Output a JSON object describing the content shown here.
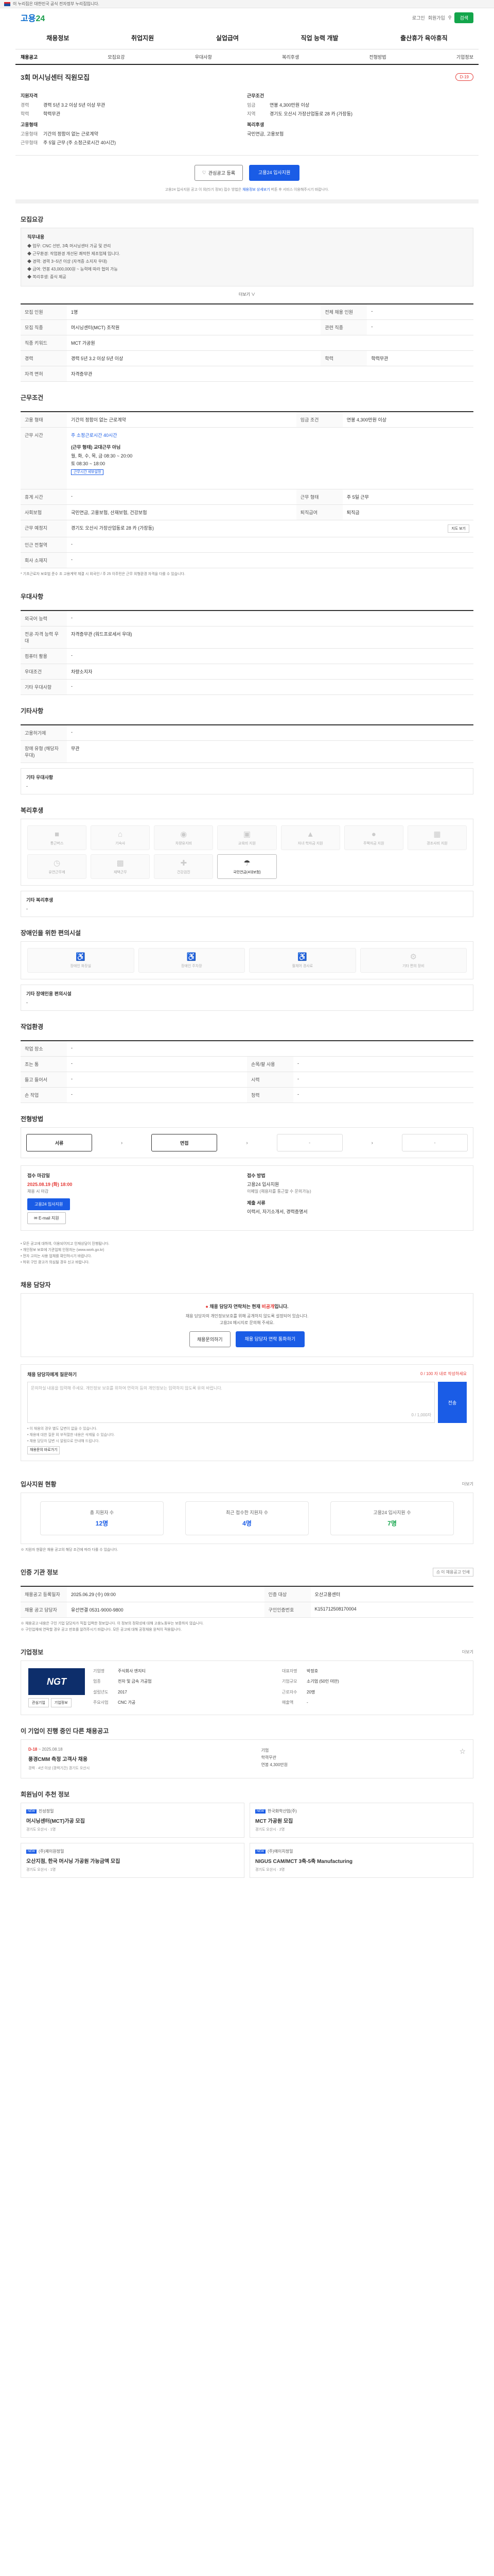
{
  "gov_bar": "이 누리집은 대한민국 공식 전자정부 누리집입니다.",
  "header": {
    "logo_a": "고용",
    "logo_b": "24",
    "login": "로그인",
    "join": "회원가입",
    "search_btn": "검색"
  },
  "gnb": [
    "채용정보",
    "취업지원",
    "실업급여",
    "직업 능력 개발",
    "출산휴가 육아휴직"
  ],
  "tabs": [
    "채용공고",
    "모집요강",
    "우대사항",
    "복리후생",
    "전형방법",
    "기업정보"
  ],
  "job": {
    "title": "3회 머시닝센터 직원모집",
    "dday": "D-19",
    "qual_title": "지원자격",
    "qual": [
      {
        "k": "경력",
        "v": "경력 5년 3.2 이상 5년 이상 무관"
      },
      {
        "k": "학력",
        "v": "학력무관"
      }
    ],
    "cond_title": "근무조건",
    "cond": [
      {
        "k": "임금",
        "v": "연봉 4,300만원 이상"
      },
      {
        "k": "지역",
        "v": "경기도 오산시 가장산업동로 28 카 (가장동)"
      }
    ],
    "emp_title": "고용형태",
    "emp": [
      {
        "k": "고용형태",
        "v": "기간의 정함이 없는 근로계약"
      },
      {
        "k": "근무형태",
        "v": "주 5일 근무 (주 소정근로시간 40시간)"
      }
    ],
    "benefit_title": "복리후생",
    "benefit": "국민연금, 고용보험"
  },
  "actions": {
    "scrap": "관심공고 등록",
    "apply": "고용24 입사지원"
  },
  "notice": {
    "text": "고용24 입사지원 공고 이 외(타기 정보) 접수 방법은",
    "link": "채용정보 상세보기",
    "tail": "버튼 후 서비스 이용해주시기 바랍니다."
  },
  "recruit": {
    "title": "모집요강",
    "box_title": "직무내용",
    "lines": [
      "◆ 업무: CNC 선반, 3축 머시닝센터 가공 및 관리",
      "◆ 근무환경: 작업환경 개선된 쾌적한 제조업체 입니다.",
      "◆ 경력: 경력 3~5년 이상 (자격증 소지자 우대)",
      "◆ 급여: 연봉 43,000,000원 ~ 능력에 따라 협의 가능",
      "◆ 복리후생: 중식 제공"
    ],
    "more": "더보기",
    "rows": [
      [
        "모집 인원",
        "1명",
        "전체 채용 인원",
        "-"
      ],
      [
        "모집 직종",
        "머시닝센터(MCT) 조작원",
        "관련 직종",
        "-"
      ],
      [
        "직종 키워드",
        "MCT  가공원",
        "",
        ""
      ],
      [
        "경력",
        "경력 5년 3.2 이상 5년 이상",
        "학력",
        "학력무관"
      ],
      [
        "자격 면허",
        "자격증무관",
        "",
        ""
      ]
    ]
  },
  "work": {
    "title": "근무조건",
    "rows": [
      [
        "고용 형태",
        "기간의 정함이 없는 근로계약",
        "임금 조건",
        "연봉 4,300만원 이상"
      ],
      [
        "근무 시간",
        "주 소정근로시간 40시간",
        "",
        ""
      ],
      [
        "",
        "",
        "",
        ""
      ],
      [
        "휴게 시간",
        "-",
        "근무 형태",
        "주 5일 근무"
      ],
      [
        "사회보험",
        "국민연금, 고용보험, 산재보험, 건강보험",
        "퇴직급여",
        "퇴직금"
      ],
      [
        "근무 예정지",
        "경기도 오산시 가장산업동로 28 카 (가장동)",
        "",
        ""
      ],
      [
        "인근 전철역",
        "-",
        "",
        ""
      ],
      [
        "회사 소재지",
        "-",
        "",
        ""
      ]
    ],
    "time_title": "(근무 형태) 교대근무 아님",
    "time_detail": "월, 화, 수, 목, 금  08:30 ~ 20:00",
    "time_detail2": "토  08:30 ~ 18:00",
    "time_tag": "근무시간 세부설정",
    "map_btn": "지도 보기",
    "note": "* 기초근로자 보호법 준수 조 고용계약 체결 시 외국인 / 주 25 이주민은 근무 외형환경 자격을 다를 수 있습니다."
  },
  "prefer": {
    "title": "우대사항",
    "rows": [
      [
        "외국어 능력",
        "-"
      ],
      [
        "전공·자격 능력 우대",
        "자격증무관 (워드프로세서 우대)"
      ],
      [
        "컴퓨터 활용",
        "-"
      ],
      [
        "우대조건",
        "차량소지자"
      ],
      [
        "기타 우대사항",
        "-"
      ]
    ]
  },
  "etc": {
    "title": "기타사항",
    "rows": [
      [
        "고용허가제",
        "-"
      ],
      [
        "장애 유형 (해당자 우대)",
        "무관"
      ]
    ],
    "extra_label": "기타 우대사항"
  },
  "welfare": {
    "title": "복리후생",
    "items": [
      "통근버스",
      "기숙사",
      "차량유지비",
      "교육비 지원",
      "자녀 학자금 지원",
      "주택자금 지원",
      "경조사비 지원",
      "유연근무제",
      "재택근무",
      "건강검진",
      "국민연금(4대보험)"
    ],
    "active_index": 10,
    "extra_label": "기타 복리후생"
  },
  "access": {
    "title": "장애인을 위한 편의시설",
    "items": [
      "장애인 화장실",
      "장애인 주차장",
      "휠체어 경사로",
      "기타 편의 장비"
    ],
    "extra_label": "기타 장애인용 편의시설"
  },
  "company_detail": {
    "title": "작업환경",
    "rows": [
      [
        "작업 장소",
        "-",
        "",
        ""
      ],
      [
        "조는 통",
        "-",
        "손목/팔 사용",
        "-"
      ],
      [
        "들고 들어서",
        "-",
        "시력",
        "-"
      ],
      [
        "손 작업",
        "-",
        "청력",
        "-"
      ]
    ]
  },
  "process": {
    "title": "전형방법",
    "steps": [
      "서류",
      "면접",
      "-",
      "-"
    ],
    "active": [
      0,
      1
    ],
    "left_label": "접수 마감일",
    "deadline": "2025.08.19 (화) 18:00",
    "deadline_sub": "채용 시 마감",
    "apply_btn": "고용24 입사지원",
    "email_btn": "E-mail 지원",
    "right_label": "접수 방법",
    "method": "고용24 입사지원",
    "method_sub": "이메일 (채용자를 통근할 수 문의가능)",
    "docs_label": "제출 서류",
    "docs": "이력서, 자기소개서, 경력증명서",
    "notes": [
      "• 모든 공고에 대하여, 이용되어지고 인재상담이 진행됩니다.",
      "• 개인정보 보호에 기관업체 인정자는 (www.work.go.kr)",
      "• 전자 고지는 사용 업체를 확인하시기 바랍니다.",
      "• 허위 구인 광고가 의심될 경우 신고 바랍니다."
    ]
  },
  "contact": {
    "title": "채용 담당자",
    "q": "채용 담당자 연락처는 현재",
    "q_red": "비공개",
    "q_tail": "입니다.",
    "lines": [
      "채용 담당자의 개인정보보호를 위해 공개하지 않도록 설정되어 있습니다.",
      "고용24 메시지로 문의해 주세요."
    ],
    "btn1": "채용문의하기",
    "btn2": "채용 담당자 연락 통화하기"
  },
  "qna": {
    "title": "채용 담당자에게 질문하기",
    "limit": "0 / 100 자 내로 작성하세요",
    "placeholder": "문의하실 내용을 입력해 주세요. 개인정보 보호를 위하여 연락처 등의 개인정보는 입력하지 않도록 유의 바랍니다.",
    "counter": "0 / 1,000자",
    "submit": "전송",
    "notes": [
      "• 이 채용의 경우 별도 답변이 없을 수 있습니다.",
      "• 채용에 대한 질문 외 부적절한 내용은 삭제될 수 있습니다.",
      "• 채용 담당자 답변 시 알림으로 안내해 드립니다."
    ],
    "link": "채용문의 바로가기"
  },
  "stats": {
    "title": "입사지원 현황",
    "more": "더보기",
    "items": [
      {
        "n": "총 지원자 수",
        "num": "12명"
      },
      {
        "n": "최근 접수한 지원자 수",
        "num": "4명"
      },
      {
        "n": "고용24 입사지원 수",
        "num": "7명"
      }
    ],
    "note": "※ 지원자 현황은 채용 공고의 해당 조건에 따라 다를 수 있습니다."
  },
  "reg": {
    "title": "인증 기관 정보",
    "print": "이 채용공고 인쇄",
    "rows": [
      [
        "채용공고 등록일자",
        "2025.06.29 (수) 09:00",
        "인증 대상",
        "오산고용센터"
      ],
      [
        "채용 공고 담당자",
        "유선연결 0531-9000-9800",
        "구인인증번호",
        "K151712508170004"
      ]
    ],
    "notes": [
      "※ 채용공고 내용은 구인 기업 담당자가 직접 입력한 정보입니다. 이 정보의 정확성에 대해 고용노동부는 보증하지 않습니다.",
      "※ 구인업체에 연락할 경우 공고 번호를 알려주시기 바랍니다. 모든 공고에 대해 공정채용 원칙이 적용됩니다."
    ]
  },
  "company": {
    "title": "기업정보",
    "more": "더보기",
    "logo": "NGT",
    "btn1": "관심기업",
    "btn2": "기업정보",
    "info": [
      [
        "기업명",
        "주식회사 엔지티"
      ],
      [
        "대표자명",
        "박정호"
      ],
      [
        "업종",
        "전자 및 금속 가공업"
      ],
      [
        "기업규모",
        "소기업 (50인 미만)"
      ],
      [
        "설립년도",
        "2017"
      ],
      [
        "근로자수",
        "20명"
      ],
      [
        "주요사업",
        "CNC 가공"
      ],
      [
        "매출액",
        "-"
      ]
    ]
  },
  "related": {
    "title": "이 기업이 진행 중인 다른 채용공고",
    "dday": "D-18",
    "date": "~ 2025.08.18",
    "job": "풍경CMM 측정 고객사 채용",
    "meta": [
      "경력",
      "4년 이상 (경력기간) 경기도 오산시"
    ],
    "right": [
      "기업",
      "학력무관",
      "연봉 4,300만원"
    ]
  },
  "recommend": {
    "title": "회원님이 추천 정보",
    "items": [
      {
        "co": "진성정밀",
        "title": "머시닝센터(MCT)가공 모집",
        "meta": "경기도 오산시 · 1명"
      },
      {
        "co": "한국화학산업(주)",
        "title": "MCT 가공원 모집",
        "meta": "경기도 오산시 · 2명"
      },
      {
        "co": "(주)제이원정밀",
        "title": "오산지점, 한국 머시닝 가공원 가능금액 모집",
        "meta": "경기도 오산시 · 1명"
      },
      {
        "co": "(주)에이치정밀",
        "title": "NIGUS CAM/MCT 3축-5축 Manufacturing",
        "meta": "경기도 오산시 · 3명"
      }
    ]
  }
}
